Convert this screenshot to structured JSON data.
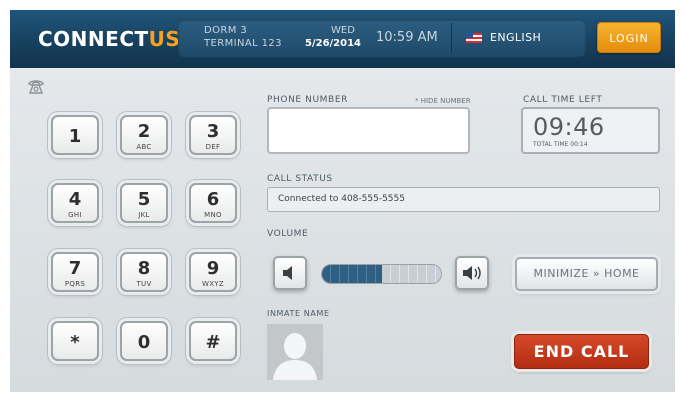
{
  "header": {
    "logo_main": "CONNECT",
    "logo_accent": "US",
    "location_line1": "DORM 3",
    "location_line2": "TERMINAL 123",
    "day": "WED",
    "date": "5/26/2014",
    "time": "10:59 AM",
    "language": "ENGLISH",
    "login_label": "LOGIN"
  },
  "keypad": {
    "keys": [
      {
        "num": "1",
        "sub": ""
      },
      {
        "num": "2",
        "sub": "ABC"
      },
      {
        "num": "3",
        "sub": "DEF"
      },
      {
        "num": "4",
        "sub": "GHI"
      },
      {
        "num": "5",
        "sub": "JKL"
      },
      {
        "num": "6",
        "sub": "MNO"
      },
      {
        "num": "7",
        "sub": "PQRS"
      },
      {
        "num": "8",
        "sub": "TUV"
      },
      {
        "num": "9",
        "sub": "WXYZ"
      },
      {
        "num": "*",
        "sub": ""
      },
      {
        "num": "0",
        "sub": ""
      },
      {
        "num": "#",
        "sub": ""
      }
    ]
  },
  "phone": {
    "label": "PHONE NUMBER",
    "hide_label": "* HIDE NUMBER",
    "value": ""
  },
  "call_time": {
    "label": "CALL TIME LEFT",
    "time_left": "09:46",
    "total": "TOTAL TIME 00:14"
  },
  "status": {
    "label": "CALL STATUS",
    "text": "Connected to 408-555-5555"
  },
  "volume": {
    "label": "VOLUME",
    "level": 0.5
  },
  "buttons": {
    "minimize": "MINIMIZE » HOME",
    "end_call": "END CALL"
  },
  "inmate": {
    "label": "INMATE NAME"
  },
  "colors": {
    "header_bg": "#1b4866",
    "accent": "#f6a21e",
    "login": "#f0a01e",
    "end_call": "#c53b1c",
    "volume_fill": "#2f5f82"
  },
  "icons": {
    "phone": "phone-handset-icon",
    "volume_down": "speaker-low-icon",
    "volume_up": "speaker-high-icon",
    "avatar": "user-silhouette-icon",
    "flag": "us-flag-icon"
  }
}
